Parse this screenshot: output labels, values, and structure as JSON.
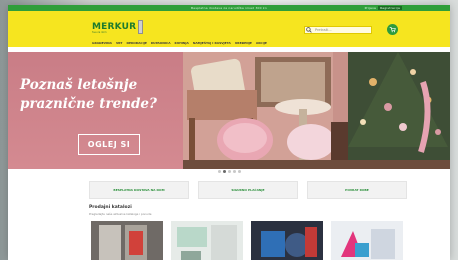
{
  "topbar": {
    "center_text": "Besplatna dostava za narudžbe iznad 300 kn",
    "links": [
      "Prijava",
      "Registracija"
    ]
  },
  "header": {
    "logo_text": "MERKUR",
    "logo_tag": "Sve za dom",
    "search_placeholder": "Pretraži..."
  },
  "nav": {
    "items": [
      "Građevina",
      "Vrt",
      "Dekoracije",
      "Kupaonica",
      "Kuhinja",
      "Namještaj i rasvjeta",
      "Uređenje",
      "Akcije"
    ]
  },
  "hero": {
    "title_line1": "Poznaš letošnje",
    "title_line2": "praznične trende?",
    "cta": "OGLEJ SI"
  },
  "slider": {
    "count": 5,
    "active_index": 1
  },
  "promos": [
    "BESPLATNA DOSTAVA NA DOM",
    "SIGURNO PLAĆANJE",
    "POVRAT ROBE"
  ],
  "section": {
    "title": "Prodajni katalozi",
    "subtitle": "Pregledajte naše aktualne kataloge i ponude"
  },
  "colors": {
    "brand_green": "#2f9e3a",
    "header_yellow": "#f6e51f",
    "hero_pink": "#c97d86"
  }
}
